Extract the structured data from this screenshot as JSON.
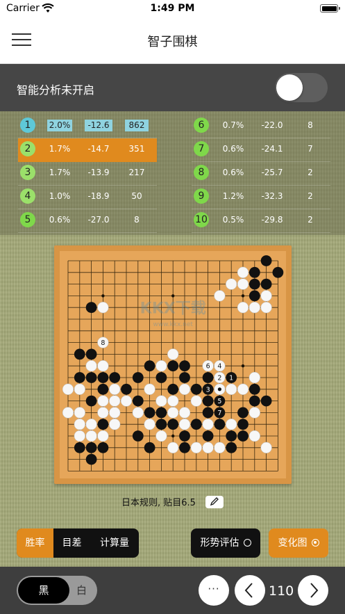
{
  "status_bar": {
    "carrier": "Carrier",
    "time": "1:49 PM"
  },
  "nav": {
    "title": "智子围棋",
    "menu_icon": "hamburger-menu-icon"
  },
  "analysis": {
    "label": "智能分析未开启",
    "enabled": false
  },
  "candidates": {
    "left": [
      {
        "rank": "1",
        "winrate": "2.0%",
        "score": "-12.6",
        "visits": "862",
        "highlight": true,
        "selected": false,
        "color": "#5ec8d8"
      },
      {
        "rank": "2",
        "winrate": "1.7%",
        "score": "-14.7",
        "visits": "351",
        "highlight": false,
        "selected": true,
        "color": "#9be06a"
      },
      {
        "rank": "3",
        "winrate": "1.7%",
        "score": "-13.9",
        "visits": "217",
        "highlight": false,
        "selected": false,
        "color": "#9be06a"
      },
      {
        "rank": "4",
        "winrate": "1.0%",
        "score": "-18.9",
        "visits": "50",
        "highlight": false,
        "selected": false,
        "color": "#9be06a"
      },
      {
        "rank": "5",
        "winrate": "0.6%",
        "score": "-27.0",
        "visits": "8",
        "highlight": false,
        "selected": false,
        "color": "#7fd84a"
      }
    ],
    "right": [
      {
        "rank": "6",
        "winrate": "0.7%",
        "score": "-22.0",
        "visits": "8",
        "color": "#7fd84a"
      },
      {
        "rank": "7",
        "winrate": "0.6%",
        "score": "-24.1",
        "visits": "7",
        "color": "#7fd84a"
      },
      {
        "rank": "8",
        "winrate": "0.6%",
        "score": "-25.7",
        "visits": "2",
        "color": "#7fd84a"
      },
      {
        "rank": "9",
        "winrate": "1.2%",
        "score": "-32.3",
        "visits": "2",
        "color": "#7fd84a"
      },
      {
        "rank": "10",
        "winrate": "0.5%",
        "score": "-29.8",
        "visits": "2",
        "color": "#7fd84a"
      }
    ]
  },
  "board": {
    "size": 19,
    "black": [
      [
        17,
        0
      ],
      [
        16,
        1
      ],
      [
        18,
        1
      ],
      [
        16,
        2
      ],
      [
        17,
        2
      ],
      [
        16,
        3
      ],
      [
        2,
        4
      ],
      [
        1,
        8
      ],
      [
        2,
        8
      ],
      [
        7,
        9
      ],
      [
        9,
        9
      ],
      [
        10,
        9
      ],
      [
        1,
        10
      ],
      [
        2,
        10
      ],
      [
        3,
        10
      ],
      [
        4,
        10
      ],
      [
        6,
        10
      ],
      [
        8,
        10
      ],
      [
        10,
        10
      ],
      [
        12,
        10
      ],
      [
        13,
        10
      ],
      [
        3,
        11
      ],
      [
        5,
        11
      ],
      [
        9,
        11
      ],
      [
        11,
        11
      ],
      [
        16,
        11
      ],
      [
        2,
        12
      ],
      [
        6,
        12
      ],
      [
        12,
        12
      ],
      [
        13,
        12
      ],
      [
        16,
        12
      ],
      [
        17,
        12
      ],
      [
        7,
        13
      ],
      [
        8,
        13
      ],
      [
        12,
        13
      ],
      [
        15,
        13
      ],
      [
        3,
        14
      ],
      [
        8,
        14
      ],
      [
        9,
        14
      ],
      [
        11,
        14
      ],
      [
        13,
        14
      ],
      [
        15,
        14
      ],
      [
        6,
        15
      ],
      [
        10,
        15
      ],
      [
        12,
        15
      ],
      [
        14,
        15
      ],
      [
        15,
        15
      ],
      [
        1,
        16
      ],
      [
        2,
        16
      ],
      [
        3,
        16
      ],
      [
        7,
        16
      ],
      [
        10,
        16
      ],
      [
        14,
        16
      ],
      [
        2,
        17
      ]
    ],
    "white": [
      [
        15,
        1
      ],
      [
        16,
        1
      ],
      [
        14,
        2
      ],
      [
        15,
        2
      ],
      [
        17,
        2
      ],
      [
        13,
        3
      ],
      [
        17,
        3
      ],
      [
        3,
        4
      ],
      [
        15,
        4
      ],
      [
        16,
        4
      ],
      [
        17,
        4
      ],
      [
        9,
        8
      ],
      [
        8,
        9
      ],
      [
        2,
        9
      ],
      [
        3,
        9
      ],
      [
        2,
        10
      ],
      [
        0,
        11
      ],
      [
        1,
        11
      ],
      [
        4,
        11
      ],
      [
        7,
        11
      ],
      [
        10,
        11
      ],
      [
        14,
        11
      ],
      [
        15,
        11
      ],
      [
        16,
        10
      ],
      [
        2,
        12
      ],
      [
        3,
        12
      ],
      [
        4,
        12
      ],
      [
        5,
        12
      ],
      [
        8,
        12
      ],
      [
        9,
        12
      ],
      [
        11,
        12
      ],
      [
        0,
        13
      ],
      [
        1,
        13
      ],
      [
        3,
        13
      ],
      [
        6,
        13
      ],
      [
        9,
        13
      ],
      [
        10,
        13
      ],
      [
        16,
        13
      ],
      [
        2,
        14
      ],
      [
        4,
        14
      ],
      [
        7,
        14
      ],
      [
        9,
        14
      ],
      [
        10,
        14
      ],
      [
        12,
        14
      ],
      [
        14,
        14
      ],
      [
        1,
        15
      ],
      [
        2,
        15
      ],
      [
        3,
        15
      ],
      [
        8,
        15
      ],
      [
        16,
        15
      ],
      [
        9,
        16
      ],
      [
        11,
        16
      ],
      [
        12,
        16
      ],
      [
        13,
        16
      ],
      [
        17,
        16
      ],
      [
        1,
        14
      ],
      [
        4,
        13
      ]
    ],
    "variation": [
      {
        "x": 3,
        "y": 7,
        "label": "8",
        "stone": "white"
      },
      {
        "x": 12,
        "y": 9,
        "label": "6",
        "stone": "white"
      },
      {
        "x": 13,
        "y": 9,
        "label": "4",
        "stone": "white"
      },
      {
        "x": 13,
        "y": 10,
        "label": "2",
        "stone": "white"
      },
      {
        "x": 14,
        "y": 10,
        "label": "1",
        "stone": "black"
      },
      {
        "x": 12,
        "y": 11,
        "label": "3",
        "stone": "black"
      },
      {
        "x": 13,
        "y": 11,
        "label": "",
        "stone": "white-current"
      },
      {
        "x": 13,
        "y": 12,
        "label": "5",
        "stone": "black"
      },
      {
        "x": 13,
        "y": 13,
        "label": "7",
        "stone": "black"
      }
    ],
    "watermark": "KKX下载",
    "watermark_url": "www.kkx.net"
  },
  "rules": {
    "text": "日本规则, 贴目6.5",
    "edit_icon": "pencil-icon"
  },
  "mode_bar": {
    "tabs": [
      "胜率",
      "目差",
      "计算量"
    ],
    "active_tab": 0,
    "evaluate_label": "形势评估",
    "variation_label": "变化图"
  },
  "bottom": {
    "black_label": "黑",
    "white_label": "白",
    "more_label": "···",
    "move_number": "110"
  }
}
